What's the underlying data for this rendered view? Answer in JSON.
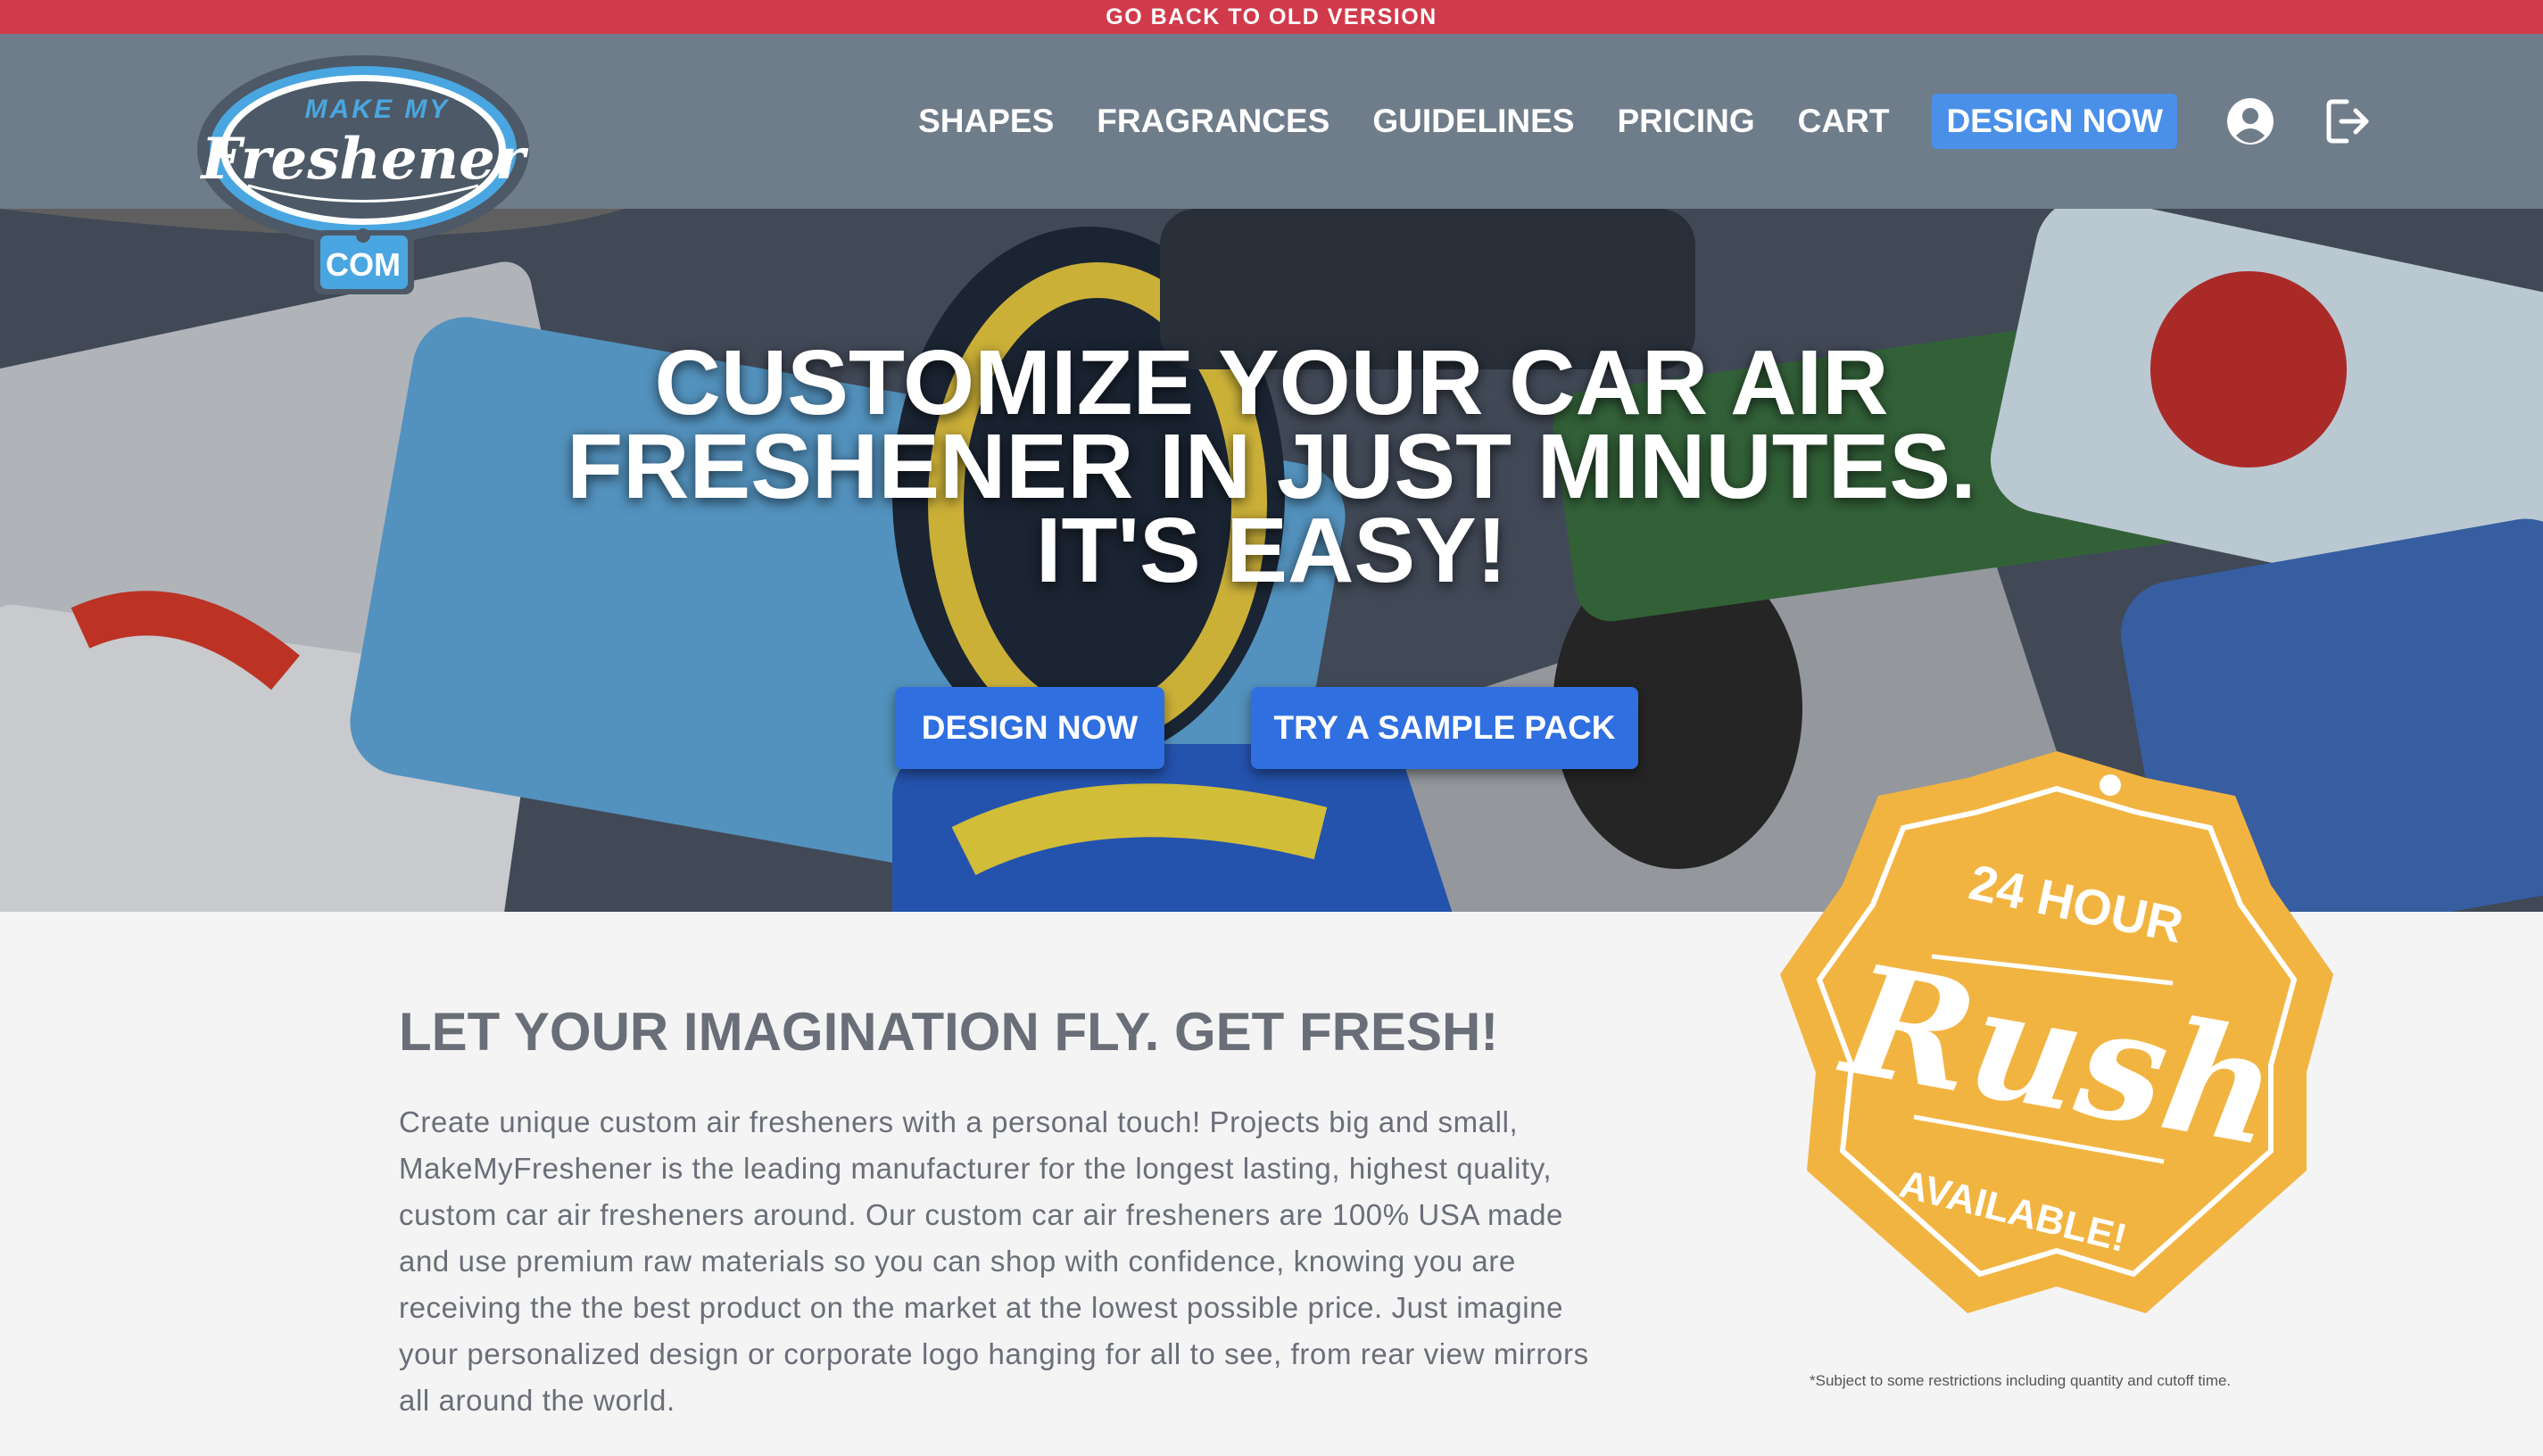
{
  "topbar": {
    "label": "GO BACK TO OLD VERSION"
  },
  "logo": {
    "top": "MAKE MY",
    "main": "Freshener",
    "tag": "COM"
  },
  "nav": {
    "items": [
      "SHAPES",
      "FRAGRANCES",
      "GUIDELINES",
      "PRICING",
      "CART"
    ],
    "cta": "DESIGN NOW"
  },
  "hero": {
    "title_lines": [
      "CUSTOMIZE YOUR CAR AIR",
      "FRESHENER IN JUST MINUTES.",
      "IT'S EASY!"
    ],
    "btn_design": "DESIGN NOW",
    "btn_sample": "TRY A SAMPLE PACK"
  },
  "content": {
    "heading": "LET YOUR IMAGINATION FLY. GET FRESH!",
    "body": "Create unique custom air fresheners with a personal touch! Projects big and small, MakeMyFreshener is the leading manufacturer for the longest lasting, highest quality, custom car air fresheners around. Our custom car air fresheners are 100% USA made and use premium raw materials so you can shop with confidence, knowing you are receiving the the best product on the market at the lowest possible price. Just imagine your personalized design or corporate logo hanging for all to see, from rear view mirrors all around the world."
  },
  "badge": {
    "top": "24 HOUR",
    "main": "Rush",
    "bottom": "AVAILABLE!",
    "note": "*Subject to some restrictions including quantity and cutoff time."
  },
  "colors": {
    "topbar": "#d03a4a",
    "header": "#6f7c8a",
    "cta": "#4a90e8",
    "hero_button": "#2f6fe0",
    "badge": "#f2b441",
    "logo_blue": "#4aa6e0"
  },
  "icons": [
    "user-circle-icon",
    "logout-icon"
  ]
}
